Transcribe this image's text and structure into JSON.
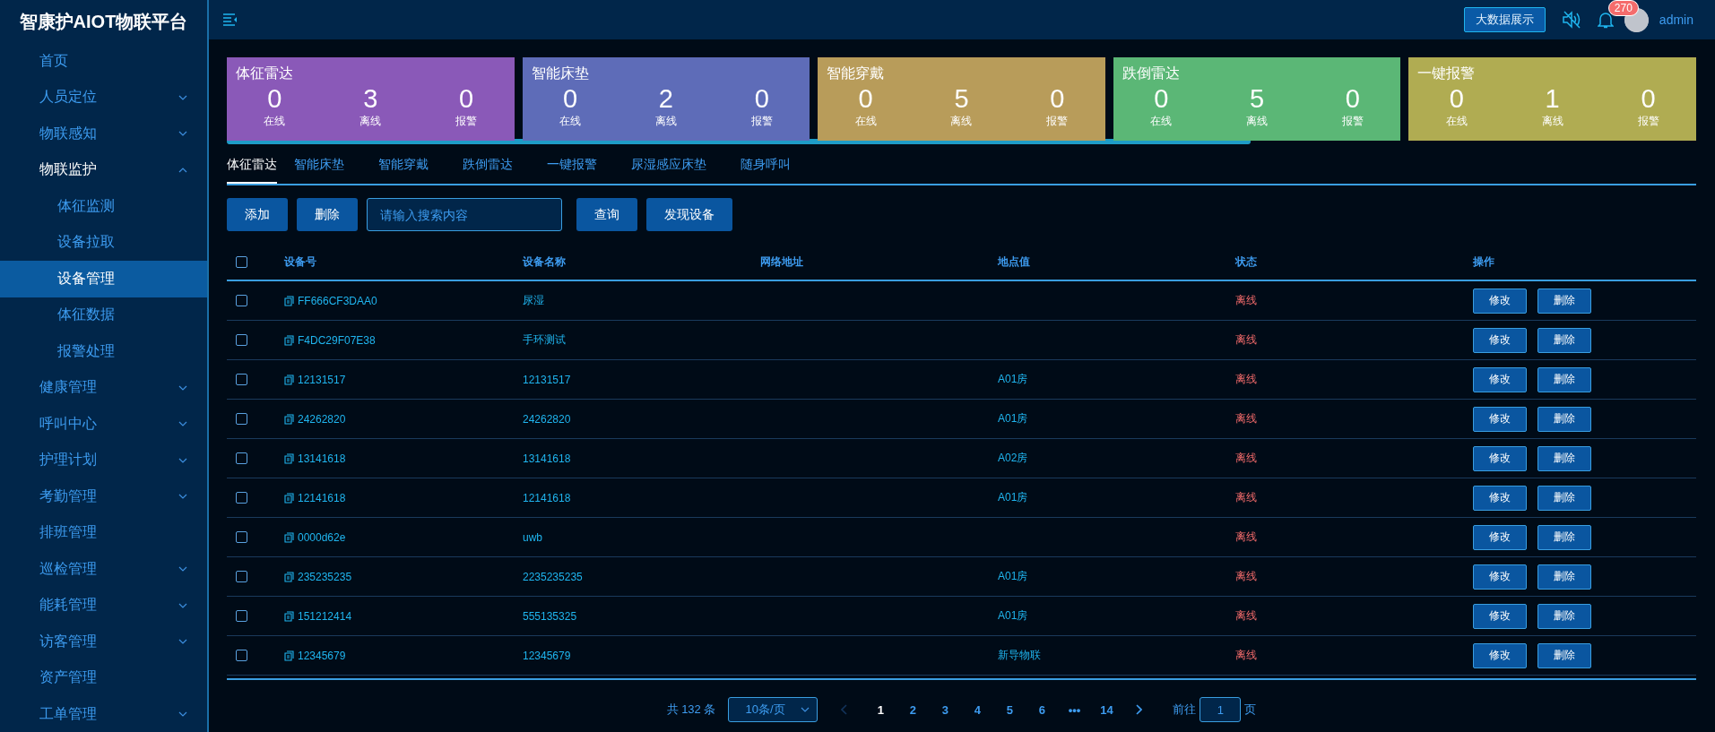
{
  "sidebar": {
    "title": "智康护AIOT物联平台",
    "items": [
      {
        "label": "首页",
        "expanded": false,
        "selected": false
      },
      {
        "label": "人员定位",
        "expanded": false,
        "selected": false,
        "has_children": true
      },
      {
        "label": "物联感知",
        "expanded": false,
        "selected": false,
        "has_children": true
      },
      {
        "label": "物联监护",
        "expanded": true,
        "selected": false,
        "has_children": true,
        "children": [
          {
            "label": "体征监测",
            "selected": false
          },
          {
            "label": "设备拉取",
            "selected": false
          },
          {
            "label": "设备管理",
            "selected": true
          },
          {
            "label": "体征数据",
            "selected": false
          },
          {
            "label": "报警处理",
            "selected": false
          }
        ]
      },
      {
        "label": "健康管理",
        "expanded": false,
        "selected": false,
        "has_children": true
      },
      {
        "label": "呼叫中心",
        "expanded": false,
        "selected": false,
        "has_children": true
      },
      {
        "label": "护理计划",
        "expanded": false,
        "selected": false,
        "has_children": true
      },
      {
        "label": "考勤管理",
        "expanded": false,
        "selected": false,
        "has_children": true
      },
      {
        "label": "排班管理",
        "expanded": false,
        "selected": false
      },
      {
        "label": "巡检管理",
        "expanded": false,
        "selected": false,
        "has_children": true
      },
      {
        "label": "能耗管理",
        "expanded": false,
        "selected": false,
        "has_children": true
      },
      {
        "label": "访客管理",
        "expanded": false,
        "selected": false,
        "has_children": true
      },
      {
        "label": "资产管理",
        "expanded": false,
        "selected": false
      },
      {
        "label": "工单管理",
        "expanded": false,
        "selected": false,
        "has_children": true
      }
    ]
  },
  "topbar": {
    "bigdata_button": "大数据展示",
    "notification_count": "270",
    "user": "admin"
  },
  "cards": [
    {
      "title": "体征雷达",
      "color": "#8a59b8",
      "stats": [
        {
          "value": "0",
          "label": "在线"
        },
        {
          "value": "3",
          "label": "离线"
        },
        {
          "value": "0",
          "label": "报警"
        }
      ]
    },
    {
      "title": "智能床垫",
      "color": "#5e6cb8",
      "stats": [
        {
          "value": "0",
          "label": "在线"
        },
        {
          "value": "2",
          "label": "离线"
        },
        {
          "value": "0",
          "label": "报警"
        }
      ]
    },
    {
      "title": "智能穿戴",
      "color": "#b89c5a",
      "stats": [
        {
          "value": "0",
          "label": "在线"
        },
        {
          "value": "5",
          "label": "离线"
        },
        {
          "value": "0",
          "label": "报警"
        }
      ]
    },
    {
      "title": "跌倒雷达",
      "color": "#5bb776",
      "stats": [
        {
          "value": "0",
          "label": "在线"
        },
        {
          "value": "5",
          "label": "离线"
        },
        {
          "value": "0",
          "label": "报警"
        }
      ]
    },
    {
      "title": "一键报警",
      "color": "#b0ac52",
      "stats": [
        {
          "value": "0",
          "label": "在线"
        },
        {
          "value": "1",
          "label": "离线"
        },
        {
          "value": "0",
          "label": "报警"
        }
      ]
    }
  ],
  "tabs": [
    {
      "label": "体征雷达",
      "selected": true
    },
    {
      "label": "智能床垫",
      "selected": false
    },
    {
      "label": "智能穿戴",
      "selected": false
    },
    {
      "label": "跌倒雷达",
      "selected": false
    },
    {
      "label": "一键报警",
      "selected": false
    },
    {
      "label": "尿湿感应床垫",
      "selected": false
    },
    {
      "label": "随身呼叫",
      "selected": false
    }
  ],
  "toolbar": {
    "add": "添加",
    "delete": "删除",
    "search_placeholder": "请输入搜索内容",
    "query": "查询",
    "discover": "发现设备"
  },
  "table": {
    "columns": [
      "设备号",
      "设备名称",
      "网络地址",
      "地点值",
      "状态",
      "操作"
    ],
    "header_checked": false,
    "rows": [
      {
        "id": "FF666CF3DAA0",
        "name": "尿湿",
        "address": "",
        "location": "",
        "status": "离线",
        "checked": false,
        "actions": [
          "修改",
          "删除"
        ]
      },
      {
        "id": "F4DC29F07E38",
        "name": "手环测试",
        "address": "",
        "location": "",
        "status": "离线",
        "checked": false,
        "actions": [
          "修改",
          "删除"
        ]
      },
      {
        "id": "12131517",
        "name": "12131517",
        "address": "",
        "location": "A01房",
        "status": "离线",
        "checked": false,
        "actions": [
          "修改",
          "删除"
        ]
      },
      {
        "id": "24262820",
        "name": "24262820",
        "address": "",
        "location": "A01房",
        "status": "离线",
        "checked": false,
        "actions": [
          "修改",
          "删除"
        ]
      },
      {
        "id": "13141618",
        "name": "13141618",
        "address": "",
        "location": "A02房",
        "status": "离线",
        "checked": false,
        "actions": [
          "修改",
          "删除"
        ]
      },
      {
        "id": "12141618",
        "name": "12141618",
        "address": "",
        "location": "A01房",
        "status": "离线",
        "checked": false,
        "actions": [
          "修改",
          "删除"
        ]
      },
      {
        "id": "0000d62e",
        "name": "uwb",
        "address": "",
        "location": "",
        "status": "离线",
        "checked": false,
        "actions": [
          "修改",
          "删除"
        ]
      },
      {
        "id": "235235235",
        "name": "2235235235",
        "address": "",
        "location": "A01房",
        "status": "离线",
        "checked": false,
        "actions": [
          "修改",
          "删除"
        ]
      },
      {
        "id": "151212414",
        "name": "555135325",
        "address": "",
        "location": "A01房",
        "status": "离线",
        "checked": false,
        "actions": [
          "修改",
          "删除"
        ]
      },
      {
        "id": "12345679",
        "name": "12345679",
        "address": "",
        "location": "新导物联",
        "status": "离线",
        "checked": false,
        "actions": [
          "修改",
          "删除"
        ]
      }
    ]
  },
  "pagination": {
    "total": "共 132 条",
    "page_size": "10条/页",
    "prev_disabled": true,
    "pages": [
      {
        "label": "1",
        "selected": true
      },
      {
        "label": "2",
        "selected": false
      },
      {
        "label": "3",
        "selected": false
      },
      {
        "label": "4",
        "selected": false
      },
      {
        "label": "5",
        "selected": false
      },
      {
        "label": "6",
        "selected": false
      },
      {
        "label": "•••",
        "selected": false
      },
      {
        "label": "14",
        "selected": false
      }
    ],
    "goto_label": "前往",
    "goto_value": "1",
    "page_suffix": "页"
  }
}
